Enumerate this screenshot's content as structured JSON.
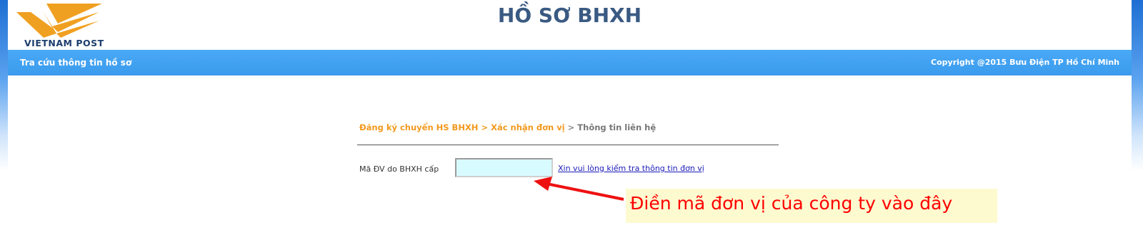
{
  "header": {
    "logo_text": "VIETNAM POST",
    "title": "HỒ SƠ BHXH"
  },
  "navbar": {
    "left_link": "Tra cứu thông tin hồ sơ",
    "copyright": "Copyright @2015 Bưu Điện TP Hồ Chí Minh"
  },
  "breadcrumb": {
    "step1": "Đăng ký chuyển HS BHXH",
    "sep1": " > ",
    "step2": "Xác nhận đơn vị",
    "sep2": " > ",
    "step3": "Thông tin liên hệ"
  },
  "form": {
    "unit_code_label": "Mã ĐV do BHXH cấp",
    "unit_code_value": "",
    "check_link": "Xin vui lòng kiểm tra thông tin đơn vị"
  },
  "annotation": {
    "text": "Điền mã đơn vị của công ty vào đây"
  },
  "colors": {
    "navbar": "#3a9bed",
    "title": "#3a5a82",
    "breadcrumb_active": "#f2991e",
    "input_bg": "#d8fbff",
    "annotation_text": "#ff0000",
    "annotation_bg": "#fdfad0",
    "logo_orange": "#f0a020"
  }
}
